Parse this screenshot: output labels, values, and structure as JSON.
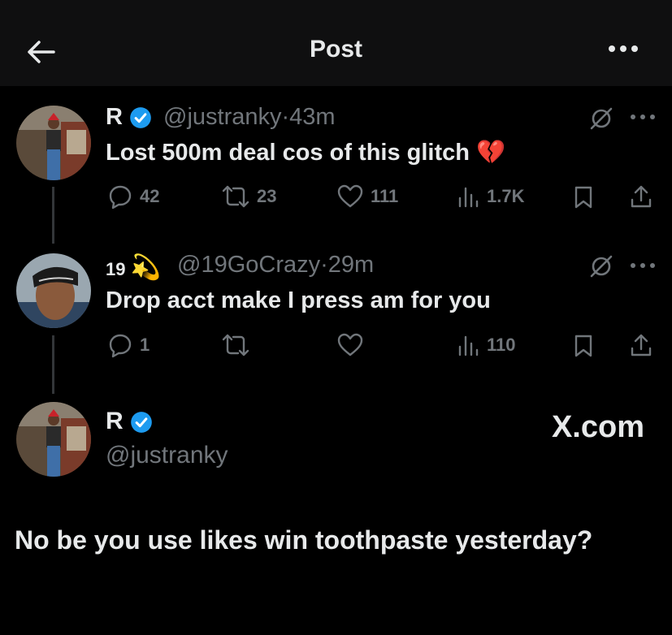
{
  "header": {
    "title": "Post"
  },
  "tweet1": {
    "name": "R",
    "handle": "@justranky",
    "time": "43m",
    "text": "Lost 500m deal cos of this glitch",
    "emoji": "💔",
    "replies": "42",
    "retweets": "23",
    "likes": "111",
    "views": "1.7K"
  },
  "tweet2": {
    "name": "19",
    "emoji": "💫",
    "handle": "@19GoCrazy",
    "time": "29m",
    "text": "Drop acct make I press am for you",
    "replies": "1",
    "views": "110"
  },
  "reply": {
    "name": "R",
    "handle": "@justranky",
    "watermark": "X.com",
    "text": "No be you use likes win toothpaste yesterday?"
  },
  "colors": {
    "verified": "#1d9bf0",
    "muted": "#71767b",
    "background": "#000000"
  }
}
